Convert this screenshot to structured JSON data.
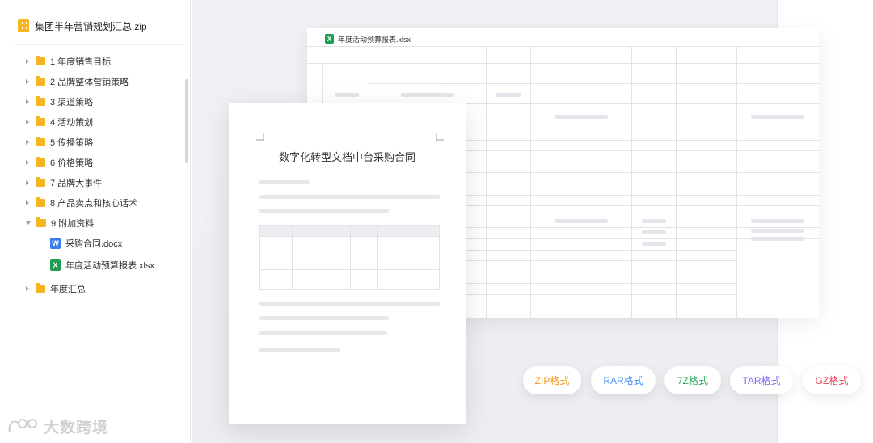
{
  "archive": {
    "name": "集团半年营销规划汇总.zip",
    "icon": "zip-icon"
  },
  "tree": {
    "folders": [
      {
        "label": "1 年度销售目标",
        "expanded": false
      },
      {
        "label": "2 品牌整体营销策略",
        "expanded": false
      },
      {
        "label": "3 渠道策略",
        "expanded": false
      },
      {
        "label": "4 活动策划",
        "expanded": false
      },
      {
        "label": "5 传播策略",
        "expanded": false
      },
      {
        "label": "6 价格策略",
        "expanded": false
      },
      {
        "label": "7 品牌大事件",
        "expanded": false
      },
      {
        "label": "8 产品卖点和核心话术",
        "expanded": false
      },
      {
        "label": "9 附加资料",
        "expanded": true
      },
      {
        "label": "年度汇总",
        "expanded": false
      }
    ],
    "files": [
      {
        "label": "采购合同.docx",
        "icon": "word-icon",
        "glyph": "W"
      },
      {
        "label": "年度活动预算报表.xlsx",
        "icon": "excel-icon",
        "glyph": "X"
      }
    ]
  },
  "spreadsheet": {
    "title": "年度活动预算报表.xlsx",
    "glyph": "X"
  },
  "document": {
    "title": "数字化转型文档中台采购合同"
  },
  "formats": [
    {
      "label": "ZIP格式",
      "color": "#f39a1f"
    },
    {
      "label": "RAR格式",
      "color": "#4a8df0"
    },
    {
      "label": "7Z格式",
      "color": "#2faa5a"
    },
    {
      "label": "TAR格式",
      "color": "#7b6cf0"
    },
    {
      "label": "GZ格式",
      "color": "#e0445c"
    }
  ],
  "watermark": {
    "text": "大数跨境"
  },
  "colors": {
    "folder": "#f5b523",
    "word": "#3b7ded",
    "excel": "#1f9d55"
  }
}
